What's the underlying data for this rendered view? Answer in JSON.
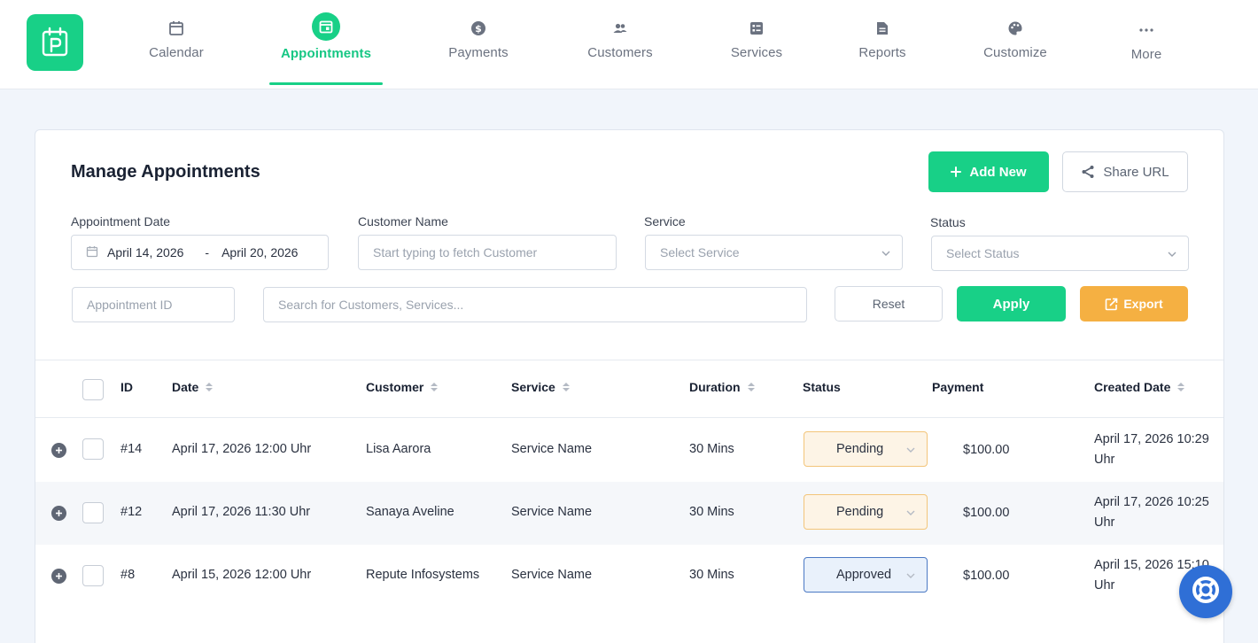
{
  "nav": {
    "items": [
      {
        "label": "Calendar",
        "icon": "calendar-icon"
      },
      {
        "label": "Appointments",
        "icon": "appointments-icon",
        "active": true
      },
      {
        "label": "Payments",
        "icon": "dollar-icon"
      },
      {
        "label": "Customers",
        "icon": "users-icon"
      },
      {
        "label": "Services",
        "icon": "services-icon"
      },
      {
        "label": "Reports",
        "icon": "reports-icon"
      },
      {
        "label": "Customize",
        "icon": "palette-icon"
      },
      {
        "label": "More",
        "icon": "more-icon"
      }
    ]
  },
  "header": {
    "title": "Manage Appointments",
    "add_new_label": "Add New",
    "share_url_label": "Share URL"
  },
  "filters": {
    "date_label": "Appointment Date",
    "date_from": "April 14, 2026",
    "date_separator": "-",
    "date_to": "April 20, 2026",
    "customer_label": "Customer Name",
    "customer_placeholder": "Start typing to fetch Customer",
    "service_label": "Service",
    "service_placeholder": "Select Service",
    "status_label": "Status",
    "status_placeholder": "Select Status",
    "appointment_id_placeholder": "Appointment ID",
    "search_placeholder": "Search for Customers, Services...",
    "reset_label": "Reset",
    "apply_label": "Apply",
    "export_label": "Export"
  },
  "table": {
    "columns": {
      "id": "ID",
      "date": "Date",
      "customer": "Customer",
      "service": "Service",
      "duration": "Duration",
      "status": "Status",
      "payment": "Payment",
      "created": "Created Date"
    },
    "rows": [
      {
        "id": "#14",
        "date": "April 17, 2026 12:00 Uhr",
        "customer": "Lisa Aarora",
        "service": "Service Name",
        "duration": "30 Mins",
        "status": "Pending",
        "payment": "$100.00",
        "created": "April 17, 2026 10:29 Uhr"
      },
      {
        "id": "#12",
        "date": "April 17, 2026 11:30 Uhr",
        "customer": "Sanaya Aveline",
        "service": "Service Name",
        "duration": "30 Mins",
        "status": "Pending",
        "payment": "$100.00",
        "created": "April 17, 2026 10:25 Uhr"
      },
      {
        "id": "#8",
        "date": "April 15, 2026 12:00 Uhr",
        "customer": "Repute Infosystems",
        "service": "Service Name",
        "duration": "30 Mins",
        "status": "Approved",
        "payment": "$100.00",
        "created": "April 15, 2026 15:10 Uhr"
      }
    ]
  },
  "colors": {
    "accent": "#18d087",
    "export": "#f5b042",
    "pending_border": "#f3c57a",
    "approved_border": "#4b79c4",
    "help": "#2f6fd6"
  }
}
